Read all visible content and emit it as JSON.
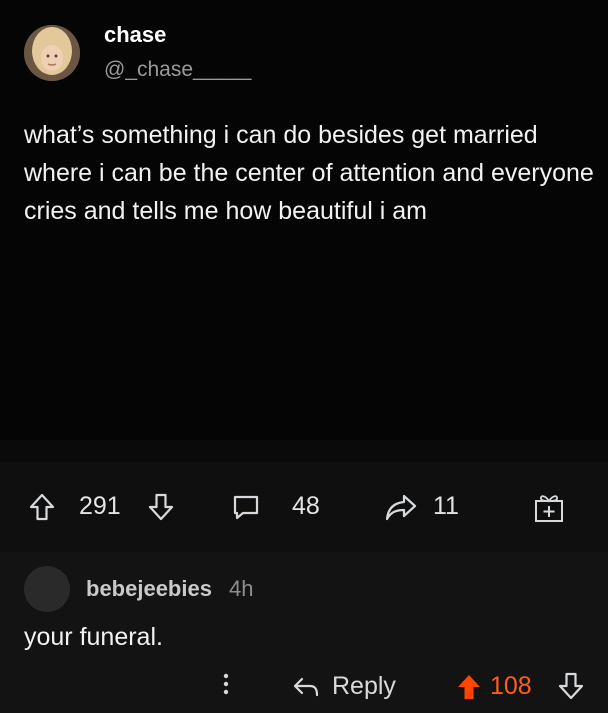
{
  "post": {
    "author_name": "chase",
    "author_handle": "@_chase_____",
    "text": "what’s something i can do besides get married where i can be the center of attention and everyone cries and tells me how beautiful i am"
  },
  "actions": {
    "upvotes": "291",
    "comments": "48",
    "shares": "11"
  },
  "comment": {
    "username": "bebejeebies",
    "time": "4h",
    "text": "your funeral.",
    "reply_label": "Reply",
    "score": "108"
  },
  "colors": {
    "upvote_active": "#ff4500",
    "score_text": "#ff5c1f",
    "background": "#000000"
  }
}
